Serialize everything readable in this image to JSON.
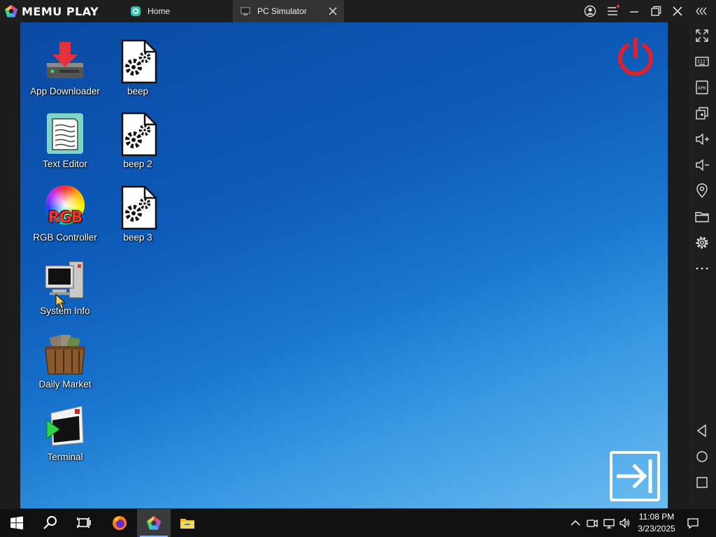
{
  "app": {
    "brand": "MEMU PLAY"
  },
  "tabs": [
    {
      "label": "Home",
      "icon": "memu-home-icon",
      "active": false
    },
    {
      "label": "PC Simulator",
      "icon": "pc-simulator-icon",
      "active": true
    }
  ],
  "window_controls": [
    "account-icon",
    "menu-icon",
    "minimize-icon",
    "restore-icon",
    "close-icon",
    "collapse-sidebar-icon"
  ],
  "sidebar": {
    "items": [
      "fullscreen-icon",
      "keyboard-icon",
      "apk-install-icon",
      "multi-instance-icon",
      "volume-up-icon",
      "volume-down-icon",
      "location-icon",
      "folder-icon",
      "settings-icon",
      "more-icon",
      "back-icon",
      "home-icon",
      "recents-icon"
    ]
  },
  "desktop": {
    "icons": [
      {
        "label": "App Downloader",
        "icon": "app-downloader-icon"
      },
      {
        "label": "beep",
        "icon": "script-file-icon"
      },
      {
        "label": "Text Editor",
        "icon": "text-editor-icon"
      },
      {
        "label": "beep 2",
        "icon": "script-file-icon"
      },
      {
        "label": "RGB Controller",
        "icon": "rgb-controller-icon"
      },
      {
        "label": "beep 3",
        "icon": "script-file-icon"
      },
      {
        "label": "System Info",
        "icon": "system-info-icon"
      },
      {
        "label": "Daily Market",
        "icon": "daily-market-icon"
      },
      {
        "label": "Terminal",
        "icon": "terminal-icon"
      }
    ],
    "rgb_badge": "RGB",
    "power_color": "#e0202a"
  },
  "taskbar": {
    "apps": [
      "windows-start-icon",
      "search-icon",
      "task-view-icon",
      "firefox-icon",
      "memu-icon",
      "file-explorer-icon"
    ],
    "tray": [
      "show-hidden-icons-icon",
      "meet-now-icon",
      "network-icon",
      "volume-icon"
    ],
    "time": "11:08 PM",
    "date": "3/23/2025",
    "notifications_icon": "notifications-icon"
  }
}
